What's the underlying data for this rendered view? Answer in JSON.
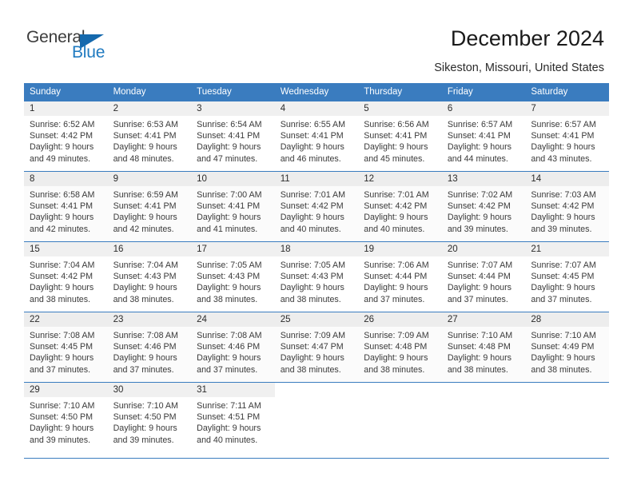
{
  "brand": {
    "name_part1": "General",
    "name_part2": "Blue",
    "logo_icon": "triangle-logo-icon"
  },
  "header": {
    "title": "December 2024",
    "location": "Sikeston, Missouri, United States"
  },
  "weekday_headers": [
    "Sunday",
    "Monday",
    "Tuesday",
    "Wednesday",
    "Thursday",
    "Friday",
    "Saturday"
  ],
  "colors": {
    "accent": "#3a7cbf",
    "brand_blue": "#1f7ac0",
    "daynum_band": "#f0f0f0",
    "text": "#3a3a3a",
    "header_text": "#ffffff"
  },
  "labels": {
    "sunrise_prefix": "Sunrise:",
    "sunset_prefix": "Sunset:",
    "daylight_prefix": "Daylight:"
  },
  "weeks": [
    [
      {
        "day": "1",
        "sunrise": "Sunrise: 6:52 AM",
        "sunset": "Sunset: 4:42 PM",
        "daylight1": "Daylight: 9 hours",
        "daylight2": "and 49 minutes."
      },
      {
        "day": "2",
        "sunrise": "Sunrise: 6:53 AM",
        "sunset": "Sunset: 4:41 PM",
        "daylight1": "Daylight: 9 hours",
        "daylight2": "and 48 minutes."
      },
      {
        "day": "3",
        "sunrise": "Sunrise: 6:54 AM",
        "sunset": "Sunset: 4:41 PM",
        "daylight1": "Daylight: 9 hours",
        "daylight2": "and 47 minutes."
      },
      {
        "day": "4",
        "sunrise": "Sunrise: 6:55 AM",
        "sunset": "Sunset: 4:41 PM",
        "daylight1": "Daylight: 9 hours",
        "daylight2": "and 46 minutes."
      },
      {
        "day": "5",
        "sunrise": "Sunrise: 6:56 AM",
        "sunset": "Sunset: 4:41 PM",
        "daylight1": "Daylight: 9 hours",
        "daylight2": "and 45 minutes."
      },
      {
        "day": "6",
        "sunrise": "Sunrise: 6:57 AM",
        "sunset": "Sunset: 4:41 PM",
        "daylight1": "Daylight: 9 hours",
        "daylight2": "and 44 minutes."
      },
      {
        "day": "7",
        "sunrise": "Sunrise: 6:57 AM",
        "sunset": "Sunset: 4:41 PM",
        "daylight1": "Daylight: 9 hours",
        "daylight2": "and 43 minutes."
      }
    ],
    [
      {
        "day": "8",
        "sunrise": "Sunrise: 6:58 AM",
        "sunset": "Sunset: 4:41 PM",
        "daylight1": "Daylight: 9 hours",
        "daylight2": "and 42 minutes."
      },
      {
        "day": "9",
        "sunrise": "Sunrise: 6:59 AM",
        "sunset": "Sunset: 4:41 PM",
        "daylight1": "Daylight: 9 hours",
        "daylight2": "and 42 minutes."
      },
      {
        "day": "10",
        "sunrise": "Sunrise: 7:00 AM",
        "sunset": "Sunset: 4:41 PM",
        "daylight1": "Daylight: 9 hours",
        "daylight2": "and 41 minutes."
      },
      {
        "day": "11",
        "sunrise": "Sunrise: 7:01 AM",
        "sunset": "Sunset: 4:42 PM",
        "daylight1": "Daylight: 9 hours",
        "daylight2": "and 40 minutes."
      },
      {
        "day": "12",
        "sunrise": "Sunrise: 7:01 AM",
        "sunset": "Sunset: 4:42 PM",
        "daylight1": "Daylight: 9 hours",
        "daylight2": "and 40 minutes."
      },
      {
        "day": "13",
        "sunrise": "Sunrise: 7:02 AM",
        "sunset": "Sunset: 4:42 PM",
        "daylight1": "Daylight: 9 hours",
        "daylight2": "and 39 minutes."
      },
      {
        "day": "14",
        "sunrise": "Sunrise: 7:03 AM",
        "sunset": "Sunset: 4:42 PM",
        "daylight1": "Daylight: 9 hours",
        "daylight2": "and 39 minutes."
      }
    ],
    [
      {
        "day": "15",
        "sunrise": "Sunrise: 7:04 AM",
        "sunset": "Sunset: 4:42 PM",
        "daylight1": "Daylight: 9 hours",
        "daylight2": "and 38 minutes."
      },
      {
        "day": "16",
        "sunrise": "Sunrise: 7:04 AM",
        "sunset": "Sunset: 4:43 PM",
        "daylight1": "Daylight: 9 hours",
        "daylight2": "and 38 minutes."
      },
      {
        "day": "17",
        "sunrise": "Sunrise: 7:05 AM",
        "sunset": "Sunset: 4:43 PM",
        "daylight1": "Daylight: 9 hours",
        "daylight2": "and 38 minutes."
      },
      {
        "day": "18",
        "sunrise": "Sunrise: 7:05 AM",
        "sunset": "Sunset: 4:43 PM",
        "daylight1": "Daylight: 9 hours",
        "daylight2": "and 38 minutes."
      },
      {
        "day": "19",
        "sunrise": "Sunrise: 7:06 AM",
        "sunset": "Sunset: 4:44 PM",
        "daylight1": "Daylight: 9 hours",
        "daylight2": "and 37 minutes."
      },
      {
        "day": "20",
        "sunrise": "Sunrise: 7:07 AM",
        "sunset": "Sunset: 4:44 PM",
        "daylight1": "Daylight: 9 hours",
        "daylight2": "and 37 minutes."
      },
      {
        "day": "21",
        "sunrise": "Sunrise: 7:07 AM",
        "sunset": "Sunset: 4:45 PM",
        "daylight1": "Daylight: 9 hours",
        "daylight2": "and 37 minutes."
      }
    ],
    [
      {
        "day": "22",
        "sunrise": "Sunrise: 7:08 AM",
        "sunset": "Sunset: 4:45 PM",
        "daylight1": "Daylight: 9 hours",
        "daylight2": "and 37 minutes."
      },
      {
        "day": "23",
        "sunrise": "Sunrise: 7:08 AM",
        "sunset": "Sunset: 4:46 PM",
        "daylight1": "Daylight: 9 hours",
        "daylight2": "and 37 minutes."
      },
      {
        "day": "24",
        "sunrise": "Sunrise: 7:08 AM",
        "sunset": "Sunset: 4:46 PM",
        "daylight1": "Daylight: 9 hours",
        "daylight2": "and 37 minutes."
      },
      {
        "day": "25",
        "sunrise": "Sunrise: 7:09 AM",
        "sunset": "Sunset: 4:47 PM",
        "daylight1": "Daylight: 9 hours",
        "daylight2": "and 38 minutes."
      },
      {
        "day": "26",
        "sunrise": "Sunrise: 7:09 AM",
        "sunset": "Sunset: 4:48 PM",
        "daylight1": "Daylight: 9 hours",
        "daylight2": "and 38 minutes."
      },
      {
        "day": "27",
        "sunrise": "Sunrise: 7:10 AM",
        "sunset": "Sunset: 4:48 PM",
        "daylight1": "Daylight: 9 hours",
        "daylight2": "and 38 minutes."
      },
      {
        "day": "28",
        "sunrise": "Sunrise: 7:10 AM",
        "sunset": "Sunset: 4:49 PM",
        "daylight1": "Daylight: 9 hours",
        "daylight2": "and 38 minutes."
      }
    ],
    [
      {
        "day": "29",
        "sunrise": "Sunrise: 7:10 AM",
        "sunset": "Sunset: 4:50 PM",
        "daylight1": "Daylight: 9 hours",
        "daylight2": "and 39 minutes."
      },
      {
        "day": "30",
        "sunrise": "Sunrise: 7:10 AM",
        "sunset": "Sunset: 4:50 PM",
        "daylight1": "Daylight: 9 hours",
        "daylight2": "and 39 minutes."
      },
      {
        "day": "31",
        "sunrise": "Sunrise: 7:11 AM",
        "sunset": "Sunset: 4:51 PM",
        "daylight1": "Daylight: 9 hours",
        "daylight2": "and 40 minutes."
      },
      {
        "day": "",
        "sunrise": "",
        "sunset": "",
        "daylight1": "",
        "daylight2": ""
      },
      {
        "day": "",
        "sunrise": "",
        "sunset": "",
        "daylight1": "",
        "daylight2": ""
      },
      {
        "day": "",
        "sunrise": "",
        "sunset": "",
        "daylight1": "",
        "daylight2": ""
      },
      {
        "day": "",
        "sunrise": "",
        "sunset": "",
        "daylight1": "",
        "daylight2": ""
      }
    ]
  ]
}
